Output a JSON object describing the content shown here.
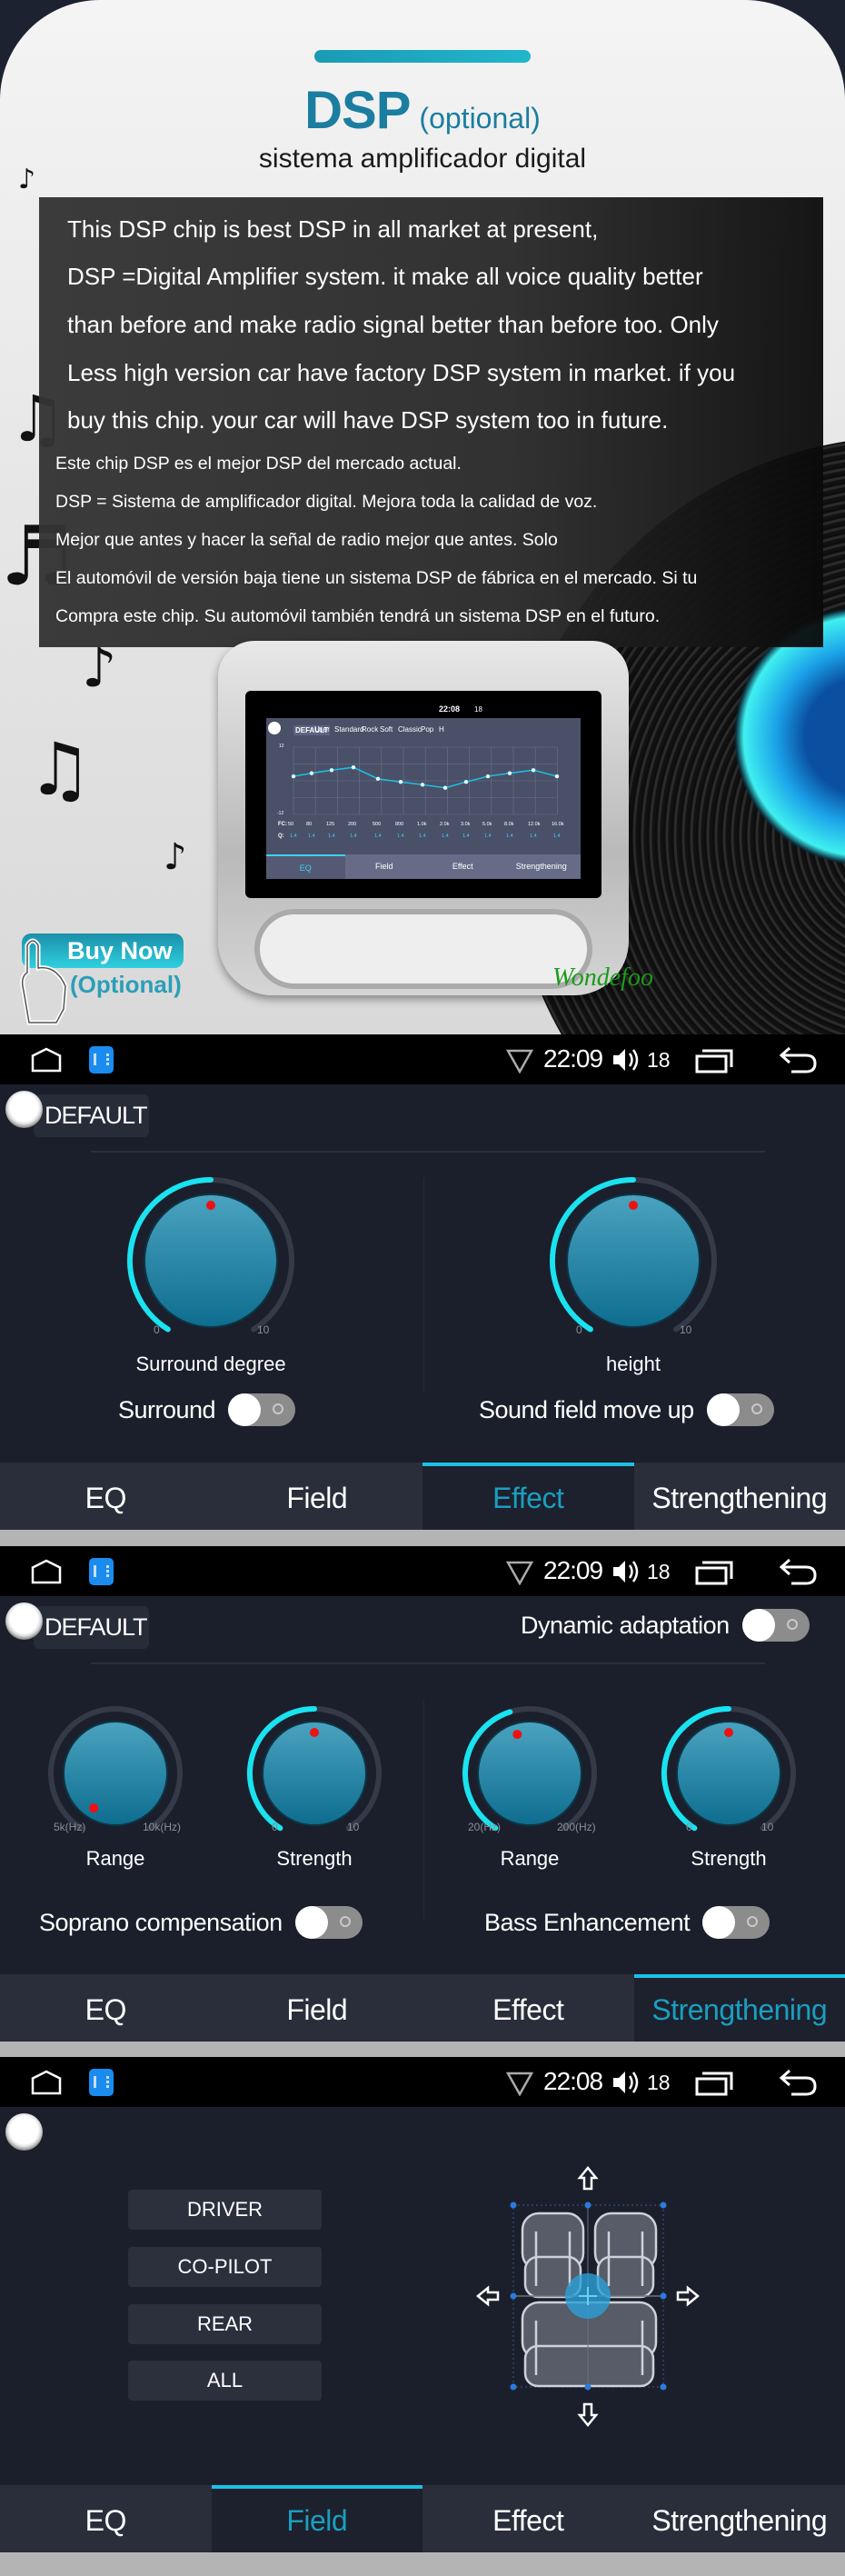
{
  "promo": {
    "title": "DSP",
    "title_suffix": "(optional)",
    "subtitle": "sistema amplificador digital",
    "english_lines": [
      "This DSP chip is best DSP in all market at present,",
      "DSP =Digital Amplifier system. it make all voice quality better",
      "than before and make radio signal better than before too. Only",
      "Less high version car have factory DSP system in market. if you",
      "buy this chip. your car will have DSP system too in future."
    ],
    "spanish_lines": [
      "Este chip DSP es el mejor DSP del mercado actual.",
      "DSP = Sistema de amplificador digital. Mejora toda la calidad de voz.",
      "Mejor que antes y hacer la señal de radio mejor que antes. Solo",
      "El automóvil de versión baja tiene un sistema DSP de fábrica en el mercado. Si tu",
      "Compra este chip. Su automóvil también tendrá un sistema DSP en el futuro."
    ],
    "buy_now": "Buy Now",
    "buy_optional": "(Optional)",
    "brand": "Wondefoo",
    "colors": {
      "title": "#1b7ea0",
      "accent": "#1ac3e6",
      "brand": "#1a9a1a"
    }
  },
  "device_preview": {
    "status": {
      "time": "22:08",
      "volume": "18"
    },
    "presets": [
      "DEFAULT",
      "User",
      "Standard",
      "Rock",
      "Soft",
      "Classic",
      "Pop",
      "H"
    ],
    "active_preset": "DEFAULT",
    "gain_range": [
      "12",
      "-12"
    ],
    "fc_label": "FC:",
    "q_label": "Q:",
    "bands": [
      "50",
      "80",
      "125",
      "200",
      "500",
      "800",
      "1.0k",
      "2.0k",
      "3.0k",
      "5.0k",
      "8.0k",
      "12.0k",
      "16.0k"
    ],
    "q_values": [
      "1.4",
      "1.4",
      "1.4",
      "1.4",
      "1.4",
      "1.4",
      "1.4",
      "1.4",
      "1.4",
      "1.4",
      "1.4",
      "1.4",
      "1.4"
    ],
    "gains": [
      1.6,
      2.7,
      3.8,
      4.8,
      0.7,
      -0.4,
      -1.4,
      -2.5,
      -0.4,
      1.6,
      2.7,
      3.8,
      1.6
    ],
    "tabs": [
      "EQ",
      "Field",
      "Effect",
      "Strengthening"
    ],
    "active_tab": 0
  },
  "panels": [
    {
      "status": {
        "time": "22:09",
        "volume": "18"
      },
      "preset": "DEFAULT",
      "tabs": [
        "EQ",
        "Field",
        "Effect",
        "Strengthening"
      ],
      "active_tab": 2,
      "knobs": [
        {
          "label": "Surround degree",
          "min_label": "0",
          "max_label": "10",
          "level": 0.5
        },
        {
          "label": "height",
          "min_label": "0",
          "max_label": "10",
          "level": 0.5
        }
      ],
      "toggles": [
        {
          "label": "Surround",
          "on": false
        },
        {
          "label": "Sound field move up",
          "on": false
        }
      ]
    },
    {
      "status": {
        "time": "22:09",
        "volume": "18"
      },
      "preset": "DEFAULT",
      "dynamic_adaptation": {
        "label": "Dynamic adaptation",
        "on": false
      },
      "tabs": [
        "EQ",
        "Field",
        "Effect",
        "Strengthening"
      ],
      "active_tab": 3,
      "knobs": [
        {
          "label": "Range",
          "min_label": "5k(Hz)",
          "max_label": "10k(Hz)",
          "level": 0.0
        },
        {
          "label": "Strength",
          "min_label": "0",
          "max_label": "10",
          "level": 0.5
        },
        {
          "label": "Range",
          "min_label": "20(Hz)",
          "max_label": "200(Hz)",
          "level": 0.44
        },
        {
          "label": "Strength",
          "min_label": "0",
          "max_label": "10",
          "level": 0.5
        }
      ],
      "toggles": [
        {
          "label": "Soprano compensation",
          "on": false
        },
        {
          "label": "Bass Enhancement",
          "on": false
        }
      ]
    },
    {
      "status": {
        "time": "22:08",
        "volume": "18"
      },
      "tabs": [
        "EQ",
        "Field",
        "Effect",
        "Strengthening"
      ],
      "active_tab": 1,
      "field_buttons": [
        "DRIVER",
        "CO-PILOT",
        "REAR",
        "ALL"
      ]
    }
  ]
}
